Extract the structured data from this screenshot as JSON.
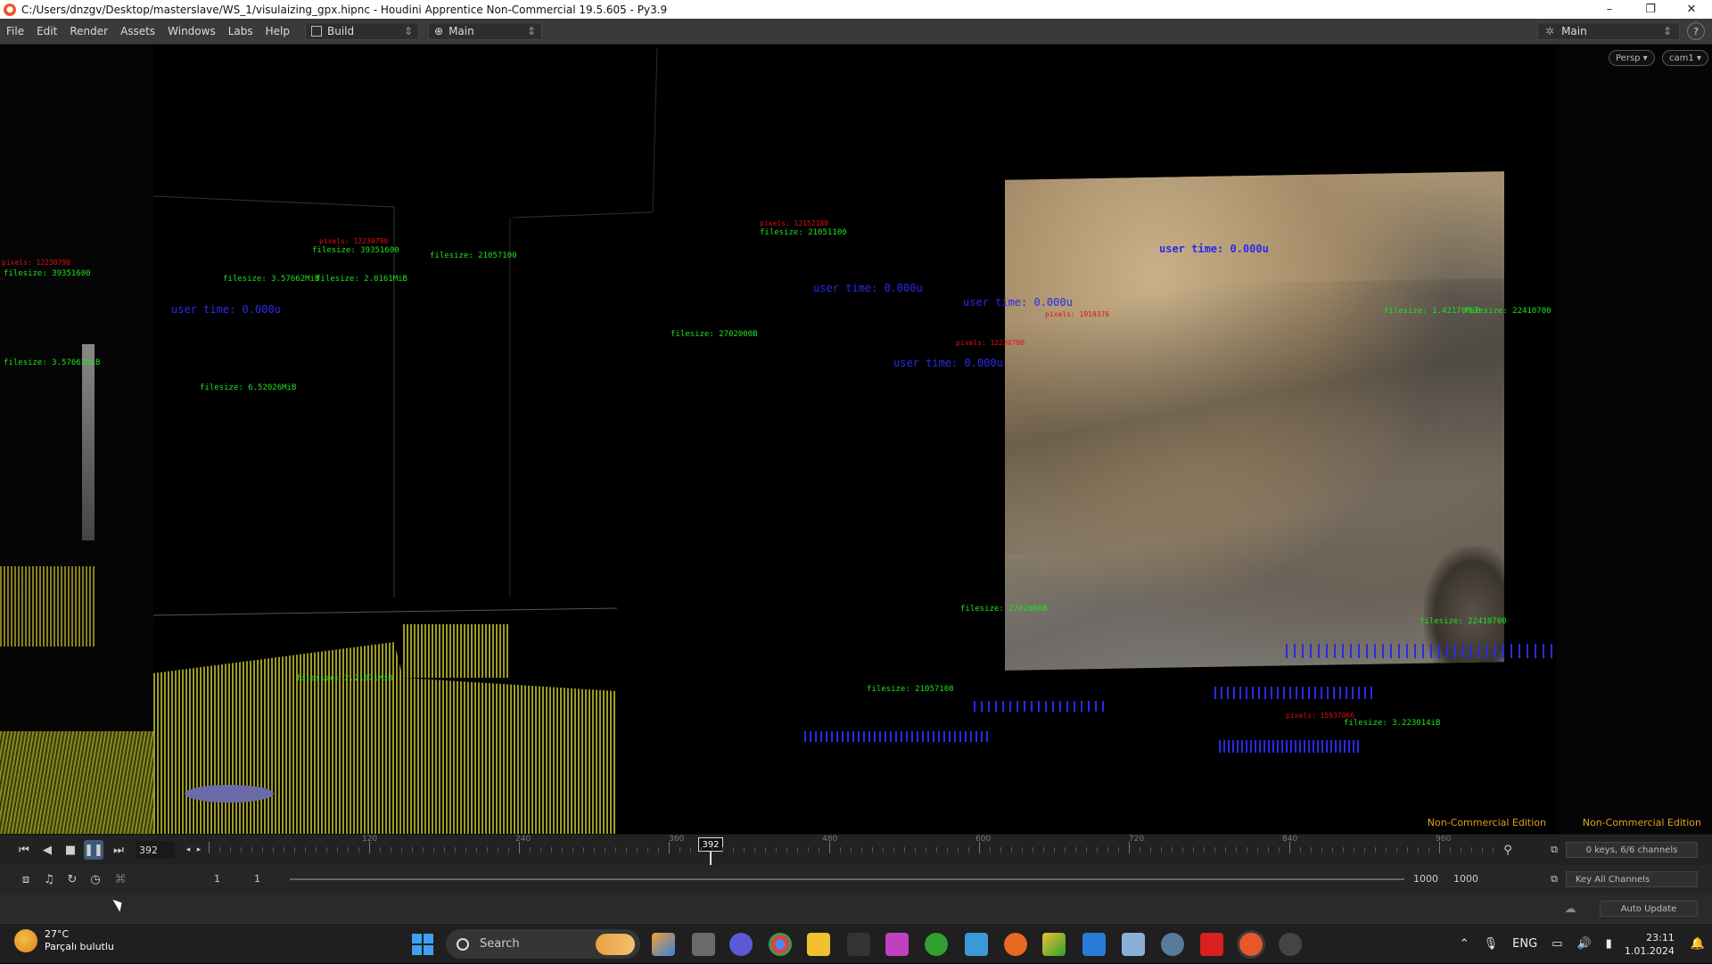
{
  "window": {
    "title": "C:/Users/dnzgv/Desktop/masterslave/WS_1/visulaizing_gpx.hipnc - Houdini Apprentice Non-Commercial 19.5.605 - Py3.9",
    "minimize": "–",
    "maximize": "❐",
    "close": "✕"
  },
  "menu": {
    "items": [
      "File",
      "Edit",
      "Render",
      "Assets",
      "Windows",
      "Labs",
      "Help"
    ],
    "desktop_left": "Build",
    "desktop_mid": "Main",
    "desktop_right": "Main",
    "help": "?"
  },
  "viewport": {
    "persp": "Persp ▾",
    "cam": "cam1 ▾",
    "edition": "Non-Commercial Edition",
    "labels_red": [
      "pixels: 12230790",
      "pixels: 12152180",
      "pixels: 1919376",
      "pixels: 12230790",
      "pixels: 15937066"
    ],
    "labels_green": [
      "filesize: 39351600",
      "filesize: 21057100",
      "filesize: 3.57662MiB",
      "filesize: 2.0161MiB",
      "filesize: 6.52026MiB",
      "filesize: 2702000B",
      "filesize: 21051100",
      "filesize: 22410700",
      "filesize: 1.42170MiB",
      "filesize: 2702080B",
      "filesize: 21057108",
      "filesize: 2.21071MiB",
      "filesize: 3.223014iB"
    ],
    "labels_blue": [
      "user time: 0.000u",
      "user time: 0.000u",
      "user time: 0.000u",
      "user time: 0.000u",
      "user time: 0.000u"
    ]
  },
  "timeline": {
    "current_frame": "392",
    "cursor_label": "392",
    "tick_labels": [
      "120",
      "240",
      "360",
      "480",
      "600",
      "720",
      "840",
      "960"
    ],
    "keys_info": "0 keys, 6/6 channels",
    "key_all": "Key All Channels",
    "range_start": "1",
    "range_start2": "1",
    "range_end": "1000",
    "range_end2": "1000",
    "auto_update": "Auto Update"
  },
  "taskbar": {
    "temperature": "27°C",
    "weather": "Parçalı bulutlu",
    "search": "Search",
    "language": "ENG",
    "time": "23:11",
    "date": "1.01.2024"
  }
}
